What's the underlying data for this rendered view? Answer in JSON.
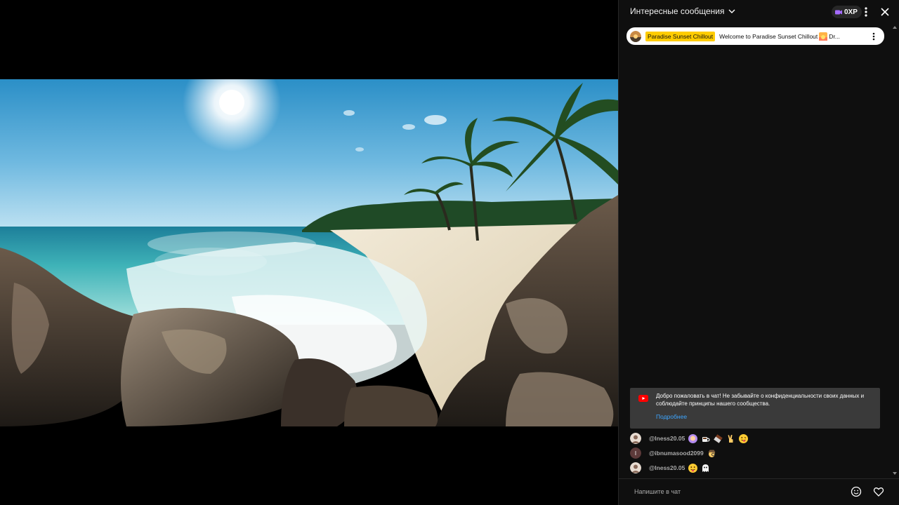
{
  "chat": {
    "mode_label": "Интересные сообщения",
    "xp_label": "0XP",
    "pinned": {
      "channel": "Paradise Sunset Chillout",
      "text": "Welcome to Paradise Sunset Chillout",
      "text_suffix": "Dr..."
    },
    "welcome": {
      "text": "Добро пожаловать в чат! Не забывайте о конфиденциальности своих данных и соблюдайте принципы нашего сообщества.",
      "link": "Подробнее"
    },
    "messages": [
      {
        "author": "@Iness20.05",
        "emojis": [
          "woman-emoji",
          "coffee-emoji",
          "chocolate-emoji",
          "victory-hand-emoji",
          "tongue-face-emoji"
        ]
      },
      {
        "author": "@ibnumasood2099",
        "avatar_letter": "I",
        "emojis": [
          "detective-emoji"
        ]
      },
      {
        "author": "@Iness20.05",
        "emojis": [
          "tongue-face-emoji",
          "ghost-emoji"
        ]
      }
    ],
    "input_placeholder": "Напишите в чат"
  },
  "colors": {
    "chat_bg": "#0f0f0f",
    "pinned_highlight": "#ffcc00",
    "link": "#3ea6ff",
    "author": "#aaaaaa"
  }
}
